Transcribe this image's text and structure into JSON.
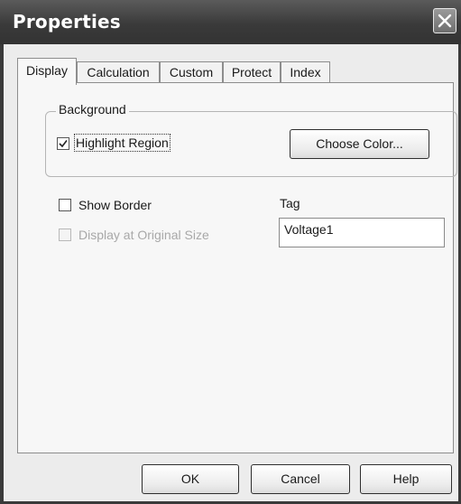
{
  "window": {
    "title": "Properties"
  },
  "tabs": [
    {
      "label": "Display",
      "active": true
    },
    {
      "label": "Calculation",
      "active": false
    },
    {
      "label": "Custom",
      "active": false
    },
    {
      "label": "Protect",
      "active": false
    },
    {
      "label": "Index",
      "active": false
    }
  ],
  "background_group": {
    "label": "Background",
    "highlight_region": {
      "label": "Highlight Region",
      "checked": true
    },
    "choose_color_button": "Choose Color..."
  },
  "show_border": {
    "label": "Show Border",
    "checked": false
  },
  "display_original_size": {
    "label": "Display at Original Size",
    "checked": false,
    "disabled": true
  },
  "tag": {
    "label": "Tag",
    "value": "Voltage1"
  },
  "buttons": {
    "ok": "OK",
    "cancel": "Cancel",
    "help": "Help"
  }
}
